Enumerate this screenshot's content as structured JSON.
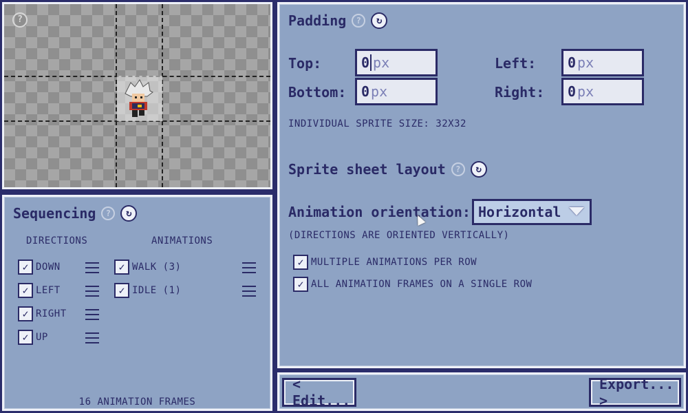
{
  "preview": {
    "help": "?"
  },
  "sequencing": {
    "title": "Sequencing",
    "help": "?",
    "refresh": "↻",
    "directions_header": "DIRECTIONS",
    "animations_header": "ANIMATIONS",
    "directions": [
      {
        "label": "DOWN",
        "checked": true
      },
      {
        "label": "LEFT",
        "checked": true
      },
      {
        "label": "RIGHT",
        "checked": true
      },
      {
        "label": "UP",
        "checked": true
      }
    ],
    "animations": [
      {
        "label": "WALK (3)",
        "checked": true
      },
      {
        "label": "IDLE (1)",
        "checked": true
      }
    ],
    "frame_count": "16 ANIMATION FRAMES"
  },
  "padding": {
    "title": "Padding",
    "help": "?",
    "refresh": "↻",
    "top_label": "Top:",
    "bottom_label": "Bottom:",
    "left_label": "Left:",
    "right_label": "Right:",
    "top_value": "0",
    "bottom_value": "0",
    "left_value": "0",
    "right_value": "0",
    "unit": "px",
    "sprite_size": "INDIVIDUAL SPRITE SIZE: 32X32"
  },
  "layout": {
    "title": "Sprite sheet layout",
    "help": "?",
    "refresh": "↻",
    "orientation_label": "Animation orientation:",
    "orientation_value": "Horizontal",
    "orientation_note": "(DIRECTIONS ARE ORIENTED VERTICALLY)",
    "option_multi": "MULTIPLE ANIMATIONS PER ROW",
    "option_single_row": "ALL ANIMATION FRAMES ON A SINGLE ROW"
  },
  "footer": {
    "edit_label": "< Edit...",
    "export_label": "Export... >"
  },
  "colors": {
    "panel": "#8ea3c4",
    "ink": "#2a2a66",
    "background": "#2b2d6b"
  }
}
